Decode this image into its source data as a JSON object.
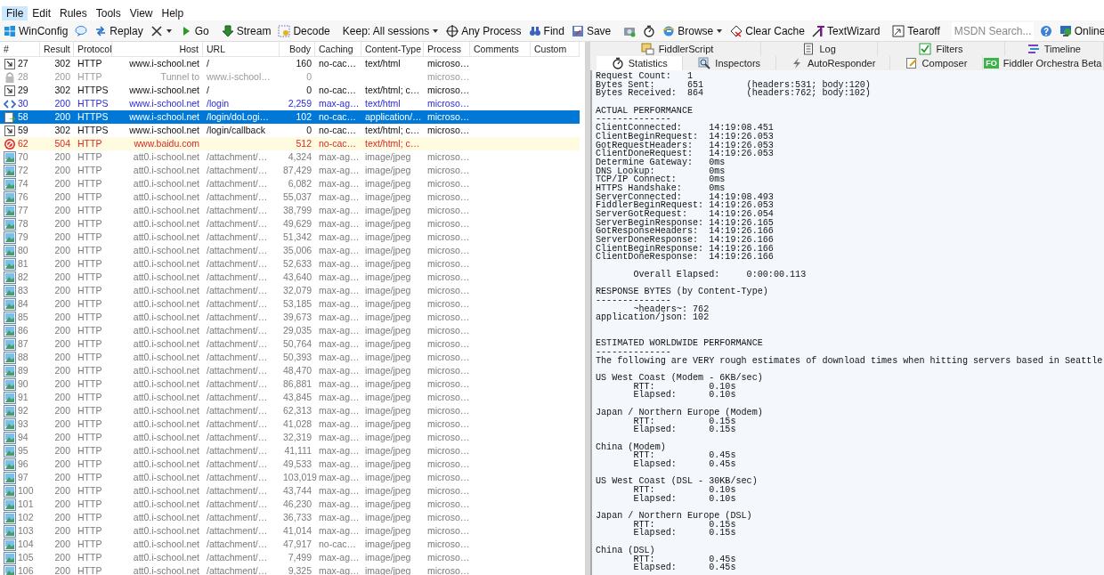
{
  "menu": [
    {
      "label": "File",
      "selected": true
    },
    {
      "label": "Edit",
      "selected": false
    },
    {
      "label": "Rules",
      "selected": false
    },
    {
      "label": "Tools",
      "selected": false
    },
    {
      "label": "View",
      "selected": false
    },
    {
      "label": "Help",
      "selected": false
    }
  ],
  "toolbar": [
    {
      "kind": "button",
      "label": "WinConfig"
    },
    {
      "kind": "icon"
    },
    {
      "kind": "button",
      "label": "Replay"
    },
    {
      "kind": "split"
    },
    {
      "kind": "button",
      "label": "Go"
    },
    {
      "kind": "separator"
    },
    {
      "kind": "button",
      "label": "Stream"
    },
    {
      "kind": "button",
      "label": "Decode"
    },
    {
      "kind": "separator"
    },
    {
      "kind": "dropdown",
      "label": "Keep: All sessions"
    },
    {
      "kind": "button",
      "label": "Any Process"
    },
    {
      "kind": "button",
      "label": "Find"
    },
    {
      "kind": "button",
      "label": "Save"
    },
    {
      "kind": "separator"
    },
    {
      "kind": "icon"
    },
    {
      "kind": "icon"
    },
    {
      "kind": "dropdown",
      "label": "Browse"
    },
    {
      "kind": "button",
      "label": "Clear Cache"
    },
    {
      "kind": "button",
      "label": "TextWizard"
    },
    {
      "kind": "separator"
    },
    {
      "kind": "button",
      "label": "Tearoff"
    },
    {
      "kind": "separator"
    },
    {
      "kind": "search",
      "placeholder": "MSDN Search..."
    },
    {
      "kind": "icon"
    },
    {
      "kind": "right",
      "label": "Online"
    }
  ],
  "sessions": {
    "columns": [
      "#",
      "Result",
      "Protocol",
      "Host",
      "URL",
      "Body",
      "Caching",
      "Content-Type",
      "Process",
      "Comments",
      "Custom"
    ],
    "rows": [
      {
        "kind": "redirect",
        "selected": false,
        "num": "27",
        "result": "302",
        "protocol": "HTTP",
        "host": "www.i-school.net",
        "url": "/",
        "body": "160",
        "caching": "no-cac…",
        "content_type": "text/html",
        "process": "microso…"
      },
      {
        "kind": "tunnel",
        "selected": false,
        "num": "28",
        "result": "200",
        "protocol": "HTTP",
        "host": "Tunnel to",
        "url": "www.i-school…",
        "body": "0",
        "process": "microso…"
      },
      {
        "kind": "redirect",
        "selected": false,
        "num": "29",
        "result": "302",
        "protocol": "HTTPS",
        "host": "www.i-school.net",
        "url": "/",
        "body": "0",
        "caching": "no-cac…",
        "content_type": "text/html; c…",
        "process": "microso…"
      },
      {
        "kind": "page",
        "selected": false,
        "num": "30",
        "result": "200",
        "protocol": "HTTPS",
        "host": "www.i-school.net",
        "url": "/login",
        "body": "2,259",
        "caching": "max-ag…",
        "content_type": "text/html",
        "process": "microso…"
      },
      {
        "kind": "json",
        "selected": true,
        "num": "58",
        "result": "200",
        "protocol": "HTTPS",
        "host": "www.i-school.net",
        "url": "/login/doLogi…",
        "body": "102",
        "caching": "no-cac…",
        "content_type": "application/…",
        "process": "microso…"
      },
      {
        "kind": "redirect",
        "selected": false,
        "num": "59",
        "result": "302",
        "protocol": "HTTPS",
        "host": "www.i-school.net",
        "url": "/login/callback",
        "body": "0",
        "caching": "no-cac…",
        "content_type": "text/html; c…",
        "process": "microso…"
      },
      {
        "kind": "error",
        "selected": false,
        "num": "62",
        "result": "504",
        "protocol": "HTTP",
        "host": "www.baidu.com",
        "body": "512",
        "caching": "no-cac…",
        "content_type": "text/html; c…"
      },
      {
        "kind": "image",
        "selected": false,
        "num": "70",
        "result": "200",
        "protocol": "HTTP",
        "host": "att0.i-school.net",
        "url": "/attachment/…",
        "body": "4,324",
        "caching": "max-ag…",
        "content_type": "image/jpeg",
        "process": "microso…"
      },
      {
        "kind": "image",
        "selected": false,
        "num": "72",
        "result": "200",
        "protocol": "HTTP",
        "host": "att0.i-school.net",
        "url": "/attachment/…",
        "body": "87,429",
        "caching": "max-ag…",
        "content_type": "image/jpeg",
        "process": "microso…"
      },
      {
        "kind": "image",
        "selected": false,
        "num": "74",
        "result": "200",
        "protocol": "HTTP",
        "host": "att0.i-school.net",
        "url": "/attachment/…",
        "body": "6,082",
        "caching": "max-ag…",
        "content_type": "image/jpeg",
        "process": "microso…"
      },
      {
        "kind": "image",
        "selected": false,
        "num": "76",
        "result": "200",
        "protocol": "HTTP",
        "host": "att0.i-school.net",
        "url": "/attachment/…",
        "body": "55,037",
        "caching": "max-ag…",
        "content_type": "image/jpeg",
        "process": "microso…"
      },
      {
        "kind": "image",
        "selected": false,
        "num": "77",
        "result": "200",
        "protocol": "HTTP",
        "host": "att0.i-school.net",
        "url": "/attachment/…",
        "body": "38,799",
        "caching": "max-ag…",
        "content_type": "image/jpeg",
        "process": "microso…"
      },
      {
        "kind": "image",
        "selected": false,
        "num": "78",
        "result": "200",
        "protocol": "HTTP",
        "host": "att0.i-school.net",
        "url": "/attachment/…",
        "body": "49,629",
        "caching": "max-ag…",
        "content_type": "image/jpeg",
        "process": "microso…"
      },
      {
        "kind": "image",
        "selected": false,
        "num": "79",
        "result": "200",
        "protocol": "HTTP",
        "host": "att0.i-school.net",
        "url": "/attachment/…",
        "body": "51,342",
        "caching": "max-ag…",
        "content_type": "image/jpeg",
        "process": "microso…"
      },
      {
        "kind": "image",
        "selected": false,
        "num": "80",
        "result": "200",
        "protocol": "HTTP",
        "host": "att0.i-school.net",
        "url": "/attachment/…",
        "body": "35,006",
        "caching": "max-ag…",
        "content_type": "image/jpeg",
        "process": "microso…"
      },
      {
        "kind": "image",
        "selected": false,
        "num": "81",
        "result": "200",
        "protocol": "HTTP",
        "host": "att0.i-school.net",
        "url": "/attachment/…",
        "body": "52,633",
        "caching": "max-ag…",
        "content_type": "image/jpeg",
        "process": "microso…"
      },
      {
        "kind": "image",
        "selected": false,
        "num": "82",
        "result": "200",
        "protocol": "HTTP",
        "host": "att0.i-school.net",
        "url": "/attachment/…",
        "body": "43,640",
        "caching": "max-ag…",
        "content_type": "image/jpeg",
        "process": "microso…"
      },
      {
        "kind": "image",
        "selected": false,
        "num": "83",
        "result": "200",
        "protocol": "HTTP",
        "host": "att0.i-school.net",
        "url": "/attachment/…",
        "body": "32,079",
        "caching": "max-ag…",
        "content_type": "image/jpeg",
        "process": "microso…"
      },
      {
        "kind": "image",
        "selected": false,
        "num": "84",
        "result": "200",
        "protocol": "HTTP",
        "host": "att0.i-school.net",
        "url": "/attachment/…",
        "body": "53,185",
        "caching": "max-ag…",
        "content_type": "image/jpeg",
        "process": "microso…"
      },
      {
        "kind": "image",
        "selected": false,
        "num": "85",
        "result": "200",
        "protocol": "HTTP",
        "host": "att0.i-school.net",
        "url": "/attachment/…",
        "body": "39,673",
        "caching": "max-ag…",
        "content_type": "image/jpeg",
        "process": "microso…"
      },
      {
        "kind": "image",
        "selected": false,
        "num": "86",
        "result": "200",
        "protocol": "HTTP",
        "host": "att0.i-school.net",
        "url": "/attachment/…",
        "body": "29,035",
        "caching": "max-ag…",
        "content_type": "image/jpeg",
        "process": "microso…"
      },
      {
        "kind": "image",
        "selected": false,
        "num": "87",
        "result": "200",
        "protocol": "HTTP",
        "host": "att0.i-school.net",
        "url": "/attachment/…",
        "body": "50,764",
        "caching": "max-ag…",
        "content_type": "image/jpeg",
        "process": "microso…"
      },
      {
        "kind": "image",
        "selected": false,
        "num": "88",
        "result": "200",
        "protocol": "HTTP",
        "host": "att0.i-school.net",
        "url": "/attachment/…",
        "body": "50,393",
        "caching": "max-ag…",
        "content_type": "image/jpeg",
        "process": "microso…"
      },
      {
        "kind": "image",
        "selected": false,
        "num": "89",
        "result": "200",
        "protocol": "HTTP",
        "host": "att0.i-school.net",
        "url": "/attachment/…",
        "body": "48,470",
        "caching": "max-ag…",
        "content_type": "image/jpeg",
        "process": "microso…"
      },
      {
        "kind": "image",
        "selected": false,
        "num": "90",
        "result": "200",
        "protocol": "HTTP",
        "host": "att0.i-school.net",
        "url": "/attachment/…",
        "body": "86,881",
        "caching": "max-ag…",
        "content_type": "image/jpeg",
        "process": "microso…"
      },
      {
        "kind": "image",
        "selected": false,
        "num": "91",
        "result": "200",
        "protocol": "HTTP",
        "host": "att0.i-school.net",
        "url": "/attachment/…",
        "body": "43,845",
        "caching": "max-ag…",
        "content_type": "image/jpeg",
        "process": "microso…"
      },
      {
        "kind": "image",
        "selected": false,
        "num": "92",
        "result": "200",
        "protocol": "HTTP",
        "host": "att0.i-school.net",
        "url": "/attachment/…",
        "body": "62,313",
        "caching": "max-ag…",
        "content_type": "image/jpeg",
        "process": "microso…"
      },
      {
        "kind": "image",
        "selected": false,
        "num": "93",
        "result": "200",
        "protocol": "HTTP",
        "host": "att0.i-school.net",
        "url": "/attachment/…",
        "body": "41,028",
        "caching": "max-ag…",
        "content_type": "image/jpeg",
        "process": "microso…"
      },
      {
        "kind": "image",
        "selected": false,
        "num": "94",
        "result": "200",
        "protocol": "HTTP",
        "host": "att0.i-school.net",
        "url": "/attachment/…",
        "body": "32,319",
        "caching": "max-ag…",
        "content_type": "image/jpeg",
        "process": "microso…"
      },
      {
        "kind": "image",
        "selected": false,
        "num": "95",
        "result": "200",
        "protocol": "HTTP",
        "host": "att0.i-school.net",
        "url": "/attachment/…",
        "body": "41,111",
        "caching": "max-ag…",
        "content_type": "image/jpeg",
        "process": "microso…"
      },
      {
        "kind": "image",
        "selected": false,
        "num": "96",
        "result": "200",
        "protocol": "HTTP",
        "host": "att0.i-school.net",
        "url": "/attachment/…",
        "body": "49,533",
        "caching": "max-ag…",
        "content_type": "image/jpeg",
        "process": "microso…"
      },
      {
        "kind": "image",
        "selected": false,
        "num": "97",
        "result": "200",
        "protocol": "HTTP",
        "host": "att0.i-school.net",
        "url": "/attachment/…",
        "body": "103,019",
        "caching": "max-ag…",
        "content_type": "image/jpeg",
        "process": "microso…"
      },
      {
        "kind": "image",
        "selected": false,
        "num": "100",
        "result": "200",
        "protocol": "HTTP",
        "host": "att0.i-school.net",
        "url": "/attachment/…",
        "body": "43,744",
        "caching": "max-ag…",
        "content_type": "image/jpeg",
        "process": "microso…"
      },
      {
        "kind": "image",
        "selected": false,
        "num": "101",
        "result": "200",
        "protocol": "HTTP",
        "host": "att0.i-school.net",
        "url": "/attachment/…",
        "body": "46,230",
        "caching": "max-ag…",
        "content_type": "image/jpeg",
        "process": "microso…"
      },
      {
        "kind": "image",
        "selected": false,
        "num": "102",
        "result": "200",
        "protocol": "HTTP",
        "host": "att0.i-school.net",
        "url": "/attachment/…",
        "body": "36,733",
        "caching": "max-ag…",
        "content_type": "image/jpeg",
        "process": "microso…"
      },
      {
        "kind": "image",
        "selected": false,
        "num": "103",
        "result": "200",
        "protocol": "HTTP",
        "host": "att0.i-school.net",
        "url": "/attachment/…",
        "body": "41,014",
        "caching": "max-ag…",
        "content_type": "image/jpeg",
        "process": "microso…"
      },
      {
        "kind": "image",
        "selected": false,
        "num": "104",
        "result": "200",
        "protocol": "HTTP",
        "host": "att0.i-school.net",
        "url": "/attachment/…",
        "body": "47,917",
        "caching": "no-cac…",
        "content_type": "image/jpeg",
        "process": "microso…"
      },
      {
        "kind": "image",
        "selected": false,
        "num": "105",
        "result": "200",
        "protocol": "HTTP",
        "host": "att0.i-school.net",
        "url": "/attachment/…",
        "body": "7,499",
        "caching": "max-ag…",
        "content_type": "image/jpeg",
        "process": "microso…"
      },
      {
        "kind": "image",
        "selected": false,
        "num": "106",
        "result": "200",
        "protocol": "HTTP",
        "host": "att0.i-school.net",
        "url": "/attachment/…",
        "body": "9,325",
        "caching": "max-ag…",
        "content_type": "image/jpeg",
        "process": "microso…"
      }
    ]
  },
  "tabs_top": [
    {
      "label": "FiddlerScript",
      "selected": false
    },
    {
      "label": "Log",
      "selected": false
    },
    {
      "label": "Filters",
      "selected": false
    },
    {
      "label": "Timeline",
      "selected": false
    }
  ],
  "tabs": [
    {
      "label": "Statistics",
      "selected": true
    },
    {
      "label": "Inspectors",
      "selected": false
    },
    {
      "label": "AutoResponder",
      "selected": false
    },
    {
      "label": "Composer",
      "selected": false
    },
    {
      "label": "Fiddler Orchestra Beta",
      "badge": "FO",
      "selected": false
    }
  ],
  "statistics": [
    {
      "kind": "plain",
      "lines": [
        "Request Count:   1",
        "Bytes Sent:      651        (headers:531; body:120)",
        "Bytes Received:  864        (headers:762; body:102)"
      ]
    },
    {
      "kind": "plain",
      "lines": [
        "ACTUAL PERFORMANCE",
        "--------------",
        "ClientConnected:     14:19:08.451",
        "ClientBeginRequest:  14:19:26.053",
        "GotRequestHeaders:   14:19:26.053",
        "ClientDoneRequest:   14:19:26.053",
        "Determine Gateway:   0ms",
        "DNS Lookup:          0ms",
        "TCP/IP Connect:      0ms",
        "HTTPS Handshake:     0ms",
        "ServerConnected:     14:19:08.493",
        "FiddlerBeginRequest: 14:19:26.053",
        "ServerGotRequest:    14:19:26.054",
        "ServerBeginResponse: 14:19:26.165",
        "GotResponseHeaders:  14:19:26.166",
        "ServerDoneResponse:  14:19:26.166",
        "ClientBeginResponse: 14:19:26.166",
        "ClientDoneResponse:  14:19:26.166"
      ]
    },
    {
      "kind": "plain",
      "lines": [
        "       Overall Elapsed:     0:00:00.113"
      ]
    },
    {
      "kind": "plain",
      "lines": [
        "RESPONSE BYTES (by Content-Type)",
        "--------------",
        "       ~headers~: 762",
        "application/json: 102"
      ]
    },
    {
      "kind": "spaced",
      "lines": [
        "ESTIMATED WORLDWIDE PERFORMANCE",
        "--------------",
        "The following are VERY rough estimates of download times when hitting servers based in Seattle"
      ]
    },
    {
      "kind": "plain",
      "lines": [
        "US West Coast (Modem - 6KB/sec)",
        "       RTT:          0.10s",
        "       Elapsed:      0.10s"
      ]
    },
    {
      "kind": "plain",
      "lines": [
        "Japan / Northern Europe (Modem)",
        "       RTT:          0.15s",
        "       Elapsed:      0.15s"
      ]
    },
    {
      "kind": "plain",
      "lines": [
        "China (Modem)",
        "       RTT:          0.45s",
        "       Elapsed:      0.45s"
      ]
    },
    {
      "kind": "plain",
      "lines": [
        "US West Coast (DSL - 30KB/sec)",
        "       RTT:          0.10s",
        "       Elapsed:      0.10s"
      ]
    },
    {
      "kind": "plain",
      "lines": [
        "Japan / Northern Europe (DSL)",
        "       RTT:          0.15s",
        "       Elapsed:      0.15s"
      ]
    },
    {
      "kind": "plain",
      "lines": [
        "China (DSL)",
        "       RTT:          0.45s",
        "       Elapsed:      0.45s"
      ]
    }
  ]
}
